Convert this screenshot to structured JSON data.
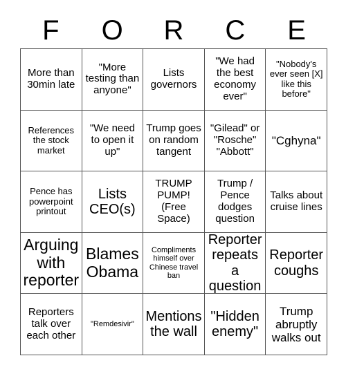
{
  "card": {
    "header_letters": [
      "F",
      "O",
      "R",
      "C",
      "E"
    ],
    "columns": 5,
    "rows": 5,
    "free_space_index": 12,
    "colors": {
      "background": "#ffffff",
      "text": "#000000",
      "grid_line": "#555555"
    },
    "cells": [
      {
        "text": "More than 30min late",
        "size": "md"
      },
      {
        "text": "\"More testing than anyone\"",
        "size": "md"
      },
      {
        "text": "Lists governors",
        "size": "md"
      },
      {
        "text": "\"We had the best economy ever\"",
        "size": "md"
      },
      {
        "text": "\"Nobody's ever seen [X] like this before\"",
        "size": "sm"
      },
      {
        "text": "References the stock market",
        "size": "sm"
      },
      {
        "text": "\"We need to open it up\"",
        "size": "md"
      },
      {
        "text": "Trump goes on random tangent",
        "size": "md"
      },
      {
        "text": "\"Gilead\" or \"Rosche\" \"Abbott\"",
        "size": "md"
      },
      {
        "text": "\"Cghyna\"",
        "size": "lg"
      },
      {
        "text": "Pence has powerpoint printout",
        "size": "sm"
      },
      {
        "text": "Lists CEO(s)",
        "size": "xl"
      },
      {
        "text": "TRUMP PUMP! (Free Space)",
        "size": "md"
      },
      {
        "text": "Trump / Pence dodges question",
        "size": "md"
      },
      {
        "text": "Talks about cruise lines",
        "size": "md"
      },
      {
        "text": "Arguing with reporter",
        "size": "xxl"
      },
      {
        "text": "Blames Obama",
        "size": "xxl"
      },
      {
        "text": "Compliments himself over Chinese travel ban",
        "size": "xs"
      },
      {
        "text": "Reporter repeats a question",
        "size": "xl"
      },
      {
        "text": "Reporter coughs",
        "size": "xl"
      },
      {
        "text": "Reporters talk over each other",
        "size": "md"
      },
      {
        "text": "\"Remdesivir\"",
        "size": "xs"
      },
      {
        "text": "Mentions the wall",
        "size": "xl"
      },
      {
        "text": "\"Hidden enemy\"",
        "size": "xl"
      },
      {
        "text": "Trump abruptly walks out",
        "size": "lg"
      }
    ]
  }
}
